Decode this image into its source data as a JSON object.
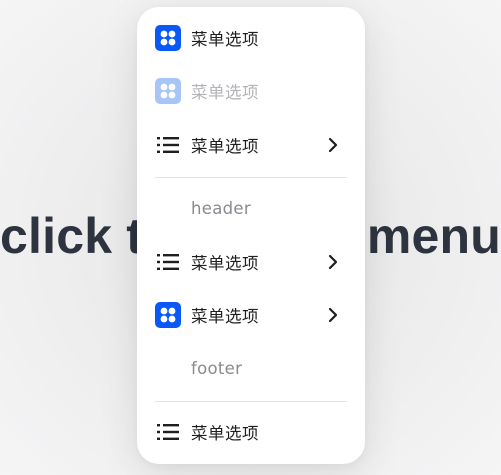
{
  "background": {
    "text_left": "click t",
    "text_right": "menu"
  },
  "menu": {
    "items": [
      {
        "label": "菜单选项",
        "icon": "apps-icon",
        "disabled": false,
        "has_submenu": false
      },
      {
        "label": "菜单选项",
        "icon": "apps-icon",
        "disabled": true,
        "has_submenu": false
      },
      {
        "label": "菜单选项",
        "icon": "list-icon",
        "disabled": false,
        "has_submenu": true
      }
    ],
    "header_label": "header",
    "group_items": [
      {
        "label": "菜单选项",
        "icon": "list-icon",
        "disabled": false,
        "has_submenu": true
      },
      {
        "label": "菜单选项",
        "icon": "apps-icon",
        "disabled": false,
        "has_submenu": true
      }
    ],
    "footer_label": "footer",
    "bottom_items": [
      {
        "label": "菜单选项",
        "icon": "list-icon",
        "disabled": false,
        "has_submenu": false
      }
    ]
  },
  "colors": {
    "accent": "#0a59f7",
    "accent_disabled": "#a7c6f7",
    "text_primary": "#1f1f22",
    "text_secondary": "#8a8a90"
  }
}
